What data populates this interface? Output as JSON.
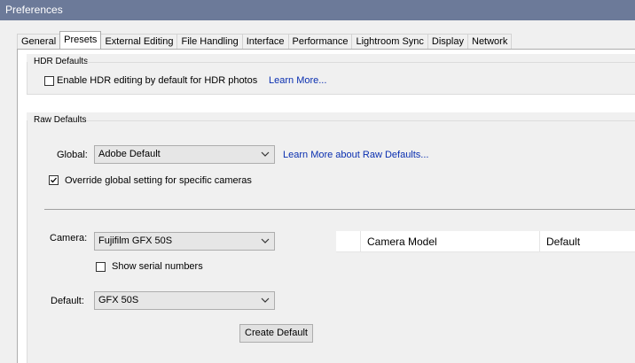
{
  "window": {
    "title": "Preferences"
  },
  "tabs": [
    {
      "label": "General",
      "active": false
    },
    {
      "label": "Presets",
      "active": true
    },
    {
      "label": "External Editing",
      "active": false
    },
    {
      "label": "File Handling",
      "active": false
    },
    {
      "label": "Interface",
      "active": false
    },
    {
      "label": "Performance",
      "active": false
    },
    {
      "label": "Lightroom Sync",
      "active": false
    },
    {
      "label": "Display",
      "active": false
    },
    {
      "label": "Network",
      "active": false
    }
  ],
  "hdr": {
    "title": "HDR Defaults",
    "checkbox_label": "Enable HDR editing by default for HDR photos",
    "checked": false,
    "link": "Learn More..."
  },
  "raw": {
    "title": "Raw Defaults",
    "global_label": "Global:",
    "global_value": "Adobe Default",
    "link": "Learn More about Raw Defaults...",
    "override_label": "Override global setting for specific cameras",
    "override_checked": true,
    "camera_label": "Camera:",
    "camera_value": "Fujifilm GFX 50S",
    "serial_label": "Show serial numbers",
    "serial_checked": false,
    "default_label": "Default:",
    "default_value": "GFX 50S",
    "create_button": "Create Default",
    "table_headers": [
      "Camera Model",
      "Default"
    ]
  }
}
